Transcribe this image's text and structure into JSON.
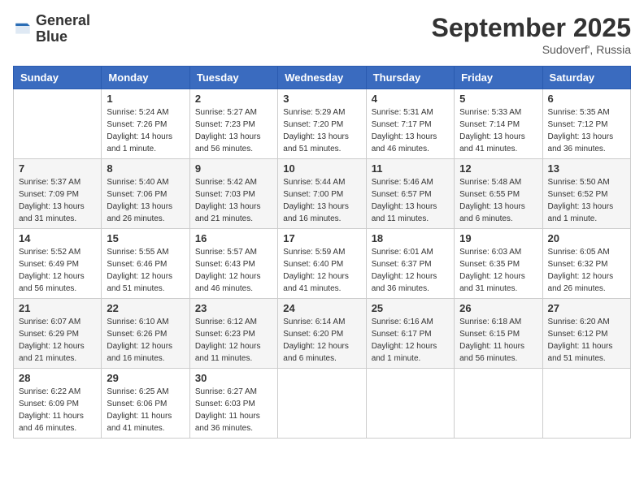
{
  "header": {
    "logo_line1": "General",
    "logo_line2": "Blue",
    "month_title": "September 2025",
    "location": "Sudoverf', Russia"
  },
  "weekdays": [
    "Sunday",
    "Monday",
    "Tuesday",
    "Wednesday",
    "Thursday",
    "Friday",
    "Saturday"
  ],
  "weeks": [
    [
      {
        "day": "",
        "info": ""
      },
      {
        "day": "1",
        "info": "Sunrise: 5:24 AM\nSunset: 7:26 PM\nDaylight: 14 hours\nand 1 minute."
      },
      {
        "day": "2",
        "info": "Sunrise: 5:27 AM\nSunset: 7:23 PM\nDaylight: 13 hours\nand 56 minutes."
      },
      {
        "day": "3",
        "info": "Sunrise: 5:29 AM\nSunset: 7:20 PM\nDaylight: 13 hours\nand 51 minutes."
      },
      {
        "day": "4",
        "info": "Sunrise: 5:31 AM\nSunset: 7:17 PM\nDaylight: 13 hours\nand 46 minutes."
      },
      {
        "day": "5",
        "info": "Sunrise: 5:33 AM\nSunset: 7:14 PM\nDaylight: 13 hours\nand 41 minutes."
      },
      {
        "day": "6",
        "info": "Sunrise: 5:35 AM\nSunset: 7:12 PM\nDaylight: 13 hours\nand 36 minutes."
      }
    ],
    [
      {
        "day": "7",
        "info": "Sunrise: 5:37 AM\nSunset: 7:09 PM\nDaylight: 13 hours\nand 31 minutes."
      },
      {
        "day": "8",
        "info": "Sunrise: 5:40 AM\nSunset: 7:06 PM\nDaylight: 13 hours\nand 26 minutes."
      },
      {
        "day": "9",
        "info": "Sunrise: 5:42 AM\nSunset: 7:03 PM\nDaylight: 13 hours\nand 21 minutes."
      },
      {
        "day": "10",
        "info": "Sunrise: 5:44 AM\nSunset: 7:00 PM\nDaylight: 13 hours\nand 16 minutes."
      },
      {
        "day": "11",
        "info": "Sunrise: 5:46 AM\nSunset: 6:57 PM\nDaylight: 13 hours\nand 11 minutes."
      },
      {
        "day": "12",
        "info": "Sunrise: 5:48 AM\nSunset: 6:55 PM\nDaylight: 13 hours\nand 6 minutes."
      },
      {
        "day": "13",
        "info": "Sunrise: 5:50 AM\nSunset: 6:52 PM\nDaylight: 13 hours\nand 1 minute."
      }
    ],
    [
      {
        "day": "14",
        "info": "Sunrise: 5:52 AM\nSunset: 6:49 PM\nDaylight: 12 hours\nand 56 minutes."
      },
      {
        "day": "15",
        "info": "Sunrise: 5:55 AM\nSunset: 6:46 PM\nDaylight: 12 hours\nand 51 minutes."
      },
      {
        "day": "16",
        "info": "Sunrise: 5:57 AM\nSunset: 6:43 PM\nDaylight: 12 hours\nand 46 minutes."
      },
      {
        "day": "17",
        "info": "Sunrise: 5:59 AM\nSunset: 6:40 PM\nDaylight: 12 hours\nand 41 minutes."
      },
      {
        "day": "18",
        "info": "Sunrise: 6:01 AM\nSunset: 6:37 PM\nDaylight: 12 hours\nand 36 minutes."
      },
      {
        "day": "19",
        "info": "Sunrise: 6:03 AM\nSunset: 6:35 PM\nDaylight: 12 hours\nand 31 minutes."
      },
      {
        "day": "20",
        "info": "Sunrise: 6:05 AM\nSunset: 6:32 PM\nDaylight: 12 hours\nand 26 minutes."
      }
    ],
    [
      {
        "day": "21",
        "info": "Sunrise: 6:07 AM\nSunset: 6:29 PM\nDaylight: 12 hours\nand 21 minutes."
      },
      {
        "day": "22",
        "info": "Sunrise: 6:10 AM\nSunset: 6:26 PM\nDaylight: 12 hours\nand 16 minutes."
      },
      {
        "day": "23",
        "info": "Sunrise: 6:12 AM\nSunset: 6:23 PM\nDaylight: 12 hours\nand 11 minutes."
      },
      {
        "day": "24",
        "info": "Sunrise: 6:14 AM\nSunset: 6:20 PM\nDaylight: 12 hours\nand 6 minutes."
      },
      {
        "day": "25",
        "info": "Sunrise: 6:16 AM\nSunset: 6:17 PM\nDaylight: 12 hours\nand 1 minute."
      },
      {
        "day": "26",
        "info": "Sunrise: 6:18 AM\nSunset: 6:15 PM\nDaylight: 11 hours\nand 56 minutes."
      },
      {
        "day": "27",
        "info": "Sunrise: 6:20 AM\nSunset: 6:12 PM\nDaylight: 11 hours\nand 51 minutes."
      }
    ],
    [
      {
        "day": "28",
        "info": "Sunrise: 6:22 AM\nSunset: 6:09 PM\nDaylight: 11 hours\nand 46 minutes."
      },
      {
        "day": "29",
        "info": "Sunrise: 6:25 AM\nSunset: 6:06 PM\nDaylight: 11 hours\nand 41 minutes."
      },
      {
        "day": "30",
        "info": "Sunrise: 6:27 AM\nSunset: 6:03 PM\nDaylight: 11 hours\nand 36 minutes."
      },
      {
        "day": "",
        "info": ""
      },
      {
        "day": "",
        "info": ""
      },
      {
        "day": "",
        "info": ""
      },
      {
        "day": "",
        "info": ""
      }
    ]
  ]
}
